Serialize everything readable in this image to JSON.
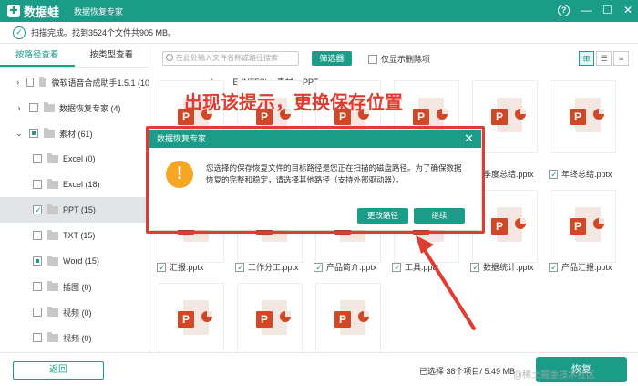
{
  "app": {
    "logo_mark": "✚",
    "name": "数据蛙",
    "subtitle": "数据恢复专家",
    "help_glyph": "?",
    "minimize_glyph": "—",
    "maximize_glyph": "☐",
    "close_glyph": "✕"
  },
  "status": {
    "icon": "check-circle-icon",
    "text": "扫描完成。找到3524个文件共905 MB。"
  },
  "left_tabs": [
    "按路径查看",
    "按类型查看"
  ],
  "tree": [
    {
      "label": "微软语音合成助手1.5.1 (10",
      "arrow": ">",
      "state": "none",
      "folder": true,
      "indent": 0
    },
    {
      "label": "数据恢复专家 (4)",
      "arrow": ">",
      "state": "none",
      "folder": true,
      "indent": 0
    },
    {
      "label": "素材 (61)",
      "arrow": "v",
      "state": "partial",
      "folder": true,
      "indent": 0
    },
    {
      "label": "Excel (0)",
      "arrow": "",
      "state": "none",
      "folder": true,
      "indent": 1
    },
    {
      "label": "Excel (18)",
      "arrow": "",
      "state": "none",
      "folder": true,
      "indent": 1
    },
    {
      "label": "PPT (15)",
      "arrow": "",
      "state": "checked",
      "folder": true,
      "indent": 1,
      "selected": true
    },
    {
      "label": "TXT (15)",
      "arrow": "",
      "state": "none",
      "folder": true,
      "indent": 1
    },
    {
      "label": "Word (15)",
      "arrow": "",
      "state": "partial",
      "folder": true,
      "indent": 1
    },
    {
      "label": "插图 (0)",
      "arrow": "",
      "state": "none",
      "folder": true,
      "indent": 1
    },
    {
      "label": "视频 (0)",
      "arrow": "",
      "state": "none",
      "folder": true,
      "indent": 1
    },
    {
      "label": "视频 (0)",
      "arrow": "",
      "state": "none",
      "folder": true,
      "indent": 1
    }
  ],
  "toolbar": {
    "search_placeholder": "在此处输入文件名称或路径搜索",
    "filter_label": "筛选器",
    "deleted_only_label": "仅显示删除项",
    "view_icons": [
      "⊞",
      "☰",
      "≡"
    ]
  },
  "path": {
    "back": "←",
    "forward": "→",
    "up": "↑",
    "text": "E:(NTFS) > 素材 > PPT"
  },
  "files": [
    {
      "name": "季度总结.pptx",
      "checked": false
    },
    {
      "name": "年终总结.pptx",
      "checked": true
    },
    {
      "name": "汇报.pptx",
      "checked": true
    },
    {
      "name": "工作分工.pptx",
      "checked": true
    },
    {
      "name": "产品简介.pptx",
      "checked": true
    },
    {
      "name": "工具.pptx",
      "checked": true
    },
    {
      "name": "数据统计.pptx",
      "checked": true
    },
    {
      "name": "产品汇报.pptx",
      "checked": true
    }
  ],
  "ppt_badge": "P",
  "footer": {
    "back_label": "返回",
    "selected_info": "已选择 38个项目/ 5.49 MB",
    "recover_label": "恢复"
  },
  "annotation": {
    "text": "出现该提示，更换保存位置"
  },
  "dialog": {
    "title": "数据恢复专家",
    "close": "✕",
    "warn_glyph": "!",
    "message": "您选择的保存恢复文件的目标路径是您正在扫描的磁盘路径。为了确保数据恢复的完整和稳定，请选择其他路径（支持外部驱动器）。",
    "change_path_label": "更改路径",
    "continue_label": "继续"
  },
  "watermark": "@稀土掘金技术社区",
  "colors": {
    "brand": "#1a9c89",
    "annotation": "#e03c31",
    "warning": "#f5a623",
    "ppt": "#d24726"
  }
}
